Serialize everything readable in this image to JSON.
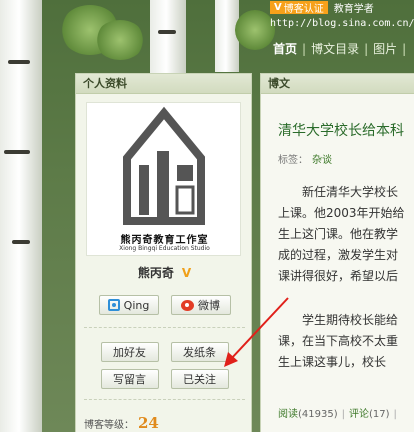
{
  "header": {
    "badge": "博客认证",
    "badge_desc": "教育学者",
    "url": "http://blog.sina.com.cn/bqx",
    "nav": [
      "首页",
      "博文目录",
      "图片"
    ]
  },
  "profile": {
    "panel_title": "个人资料",
    "avatar_caption_cn": "熊丙奇教育工作室",
    "avatar_caption_en": "Xiong Bingqi Education Studio",
    "username": "熊丙奇",
    "qing_label": "Qing",
    "weibo_label": "微博",
    "add_friend": "加好友",
    "send_note": "发纸条",
    "leave_message": "写留言",
    "followed": "已关注",
    "level_label": "博客等级：",
    "level_value": "24"
  },
  "article": {
    "panel_title": "博文",
    "title": "清华大学校长给本科",
    "tags_label": "标签：",
    "tag": "杂谈",
    "para1": [
      "新任清华大学校长",
      "上课。他2003年开始给",
      "生上这门课。他在教学",
      "成的过程，激发学生对",
      "课讲得很好，希望以后"
    ],
    "para2": [
      "学生期待校长能给",
      "课，在当下高校不太重",
      "生上课这事儿，校长"
    ],
    "read_label": "阅读",
    "read_count": "(41935)",
    "comment_label": "评论",
    "comment_count": "(17)"
  },
  "colors": {
    "accent_green": "#2a6b2a",
    "badge_orange": "#f7a11a",
    "annotation_red": "#e0201a"
  }
}
